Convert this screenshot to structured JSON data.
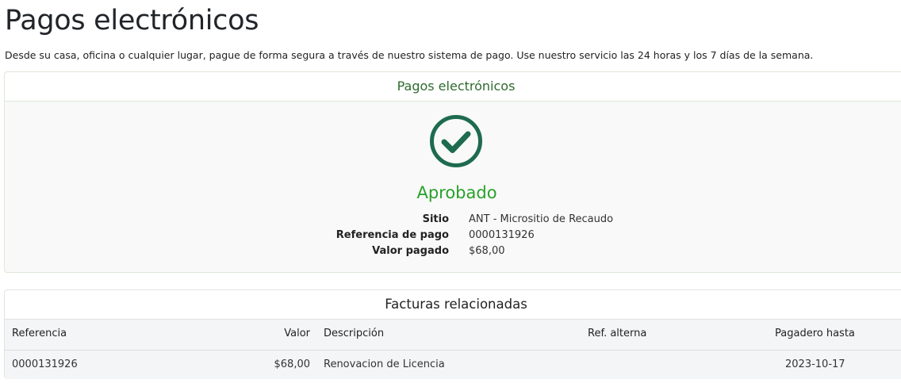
{
  "page": {
    "title": "Pagos electrónicos",
    "intro": "Desde su casa, oficina o cualquier lugar, pague de forma segura a través de nuestro sistema de pago. Use nuestro servicio las 24 horas y los 7 días de la semana."
  },
  "payment_card": {
    "header": "Pagos electrónicos",
    "status_icon": "check-circle-icon",
    "status": "Aprobado",
    "details": [
      {
        "label": "Sitio",
        "value": "ANT - Micrositio de Recaudo"
      },
      {
        "label": "Referencia de pago",
        "value": "0000131926"
      },
      {
        "label": "Valor pagado",
        "value": "$68,00"
      }
    ]
  },
  "invoices": {
    "header": "Facturas relacionadas",
    "columns": [
      "Referencia",
      "Valor",
      "Descripción",
      "Ref. alterna",
      "Pagadero hasta"
    ],
    "rows": [
      [
        "0000131926",
        "$68,00",
        "Renovacion de Licencia",
        "",
        "2023-10-17"
      ]
    ]
  },
  "colors": {
    "approved": "#2aa02a",
    "check_icon": "#1e6b4f",
    "header_green": "#2e6b2e"
  }
}
